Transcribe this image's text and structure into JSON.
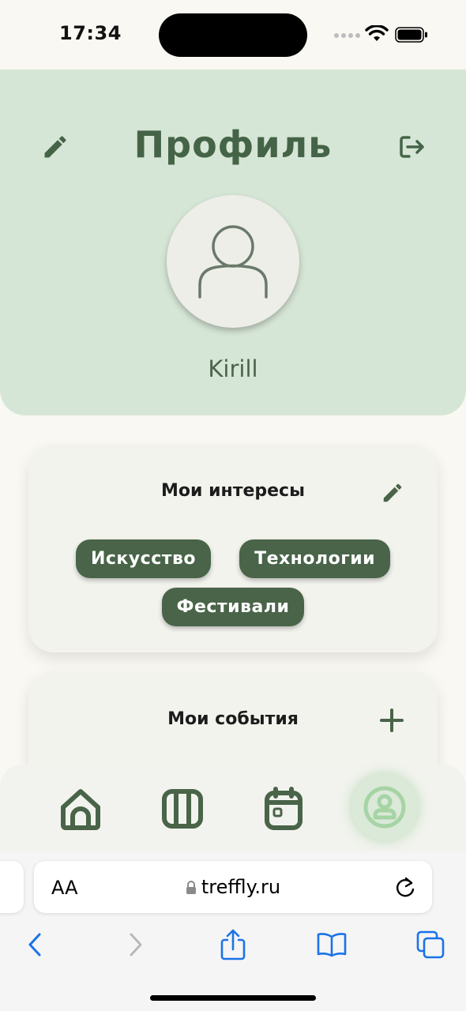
{
  "status_bar": {
    "time": "17:34"
  },
  "header": {
    "title": "Профиль",
    "username": "Kirill"
  },
  "interests": {
    "title": "Мои интересы",
    "tags": [
      "Искусство",
      "Технологии",
      "Фестивали"
    ]
  },
  "events": {
    "title": "Мои события"
  },
  "bottom_nav": {
    "items": [
      "home-icon",
      "map-icon",
      "calendar-icon",
      "profile-icon"
    ],
    "active": "profile-icon"
  },
  "browser": {
    "text_size_label": "AA",
    "url": "treffly.ru"
  },
  "colors": {
    "accent": "#496448",
    "header_bg": "#d6e6d6",
    "page_bg": "#faf8f3",
    "card_bg": "#f3f3ee",
    "browser_blue": "#1a73e8"
  }
}
